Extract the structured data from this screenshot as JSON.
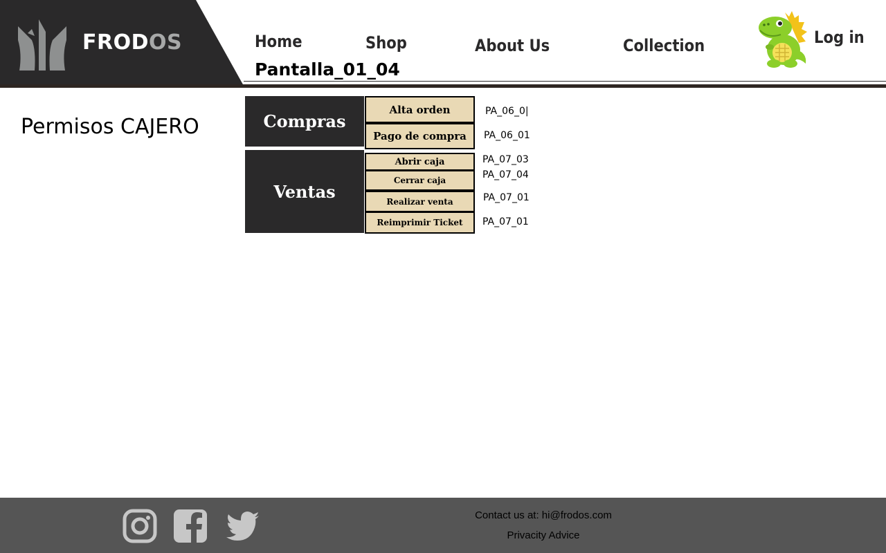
{
  "brand": {
    "name_part1": "FROD",
    "name_part2": "OS",
    "dark_color": "#2a292a",
    "grey_color": "#a7a8a8"
  },
  "nav": {
    "items": [
      {
        "label": "Home"
      },
      {
        "label": "Shop"
      },
      {
        "label": "About Us"
      },
      {
        "label": "Collection"
      }
    ],
    "login_label": "Log in",
    "avatar_icon": "green-dinosaur-icon"
  },
  "page": {
    "code": "Pantalla_01_04",
    "title": "Permisos CAJERO"
  },
  "permissions": {
    "accent_color": "#e9d9b5",
    "groups": [
      {
        "name": "Compras",
        "items": [
          {
            "label": "Alta orden",
            "code": "PA_06_0|"
          },
          {
            "label": "Pago de compra",
            "code": "PA_06_01"
          }
        ]
      },
      {
        "name": "Ventas",
        "items": [
          {
            "label": "Abrir caja",
            "code": "PA_07_03"
          },
          {
            "label": "Cerrar caja",
            "code": "PA_07_04"
          },
          {
            "label": "Realizar venta",
            "code": "PA_07_01"
          },
          {
            "label": "Reimprimir Ticket",
            "code": "PA_07_01"
          }
        ]
      }
    ]
  },
  "footer": {
    "social_icons": [
      "instagram-icon",
      "facebook-icon",
      "twitter-icon"
    ],
    "contact": "Contact us at: hi@frodos.com",
    "privacy": "Privacity Advice",
    "background_color": "#555555"
  }
}
